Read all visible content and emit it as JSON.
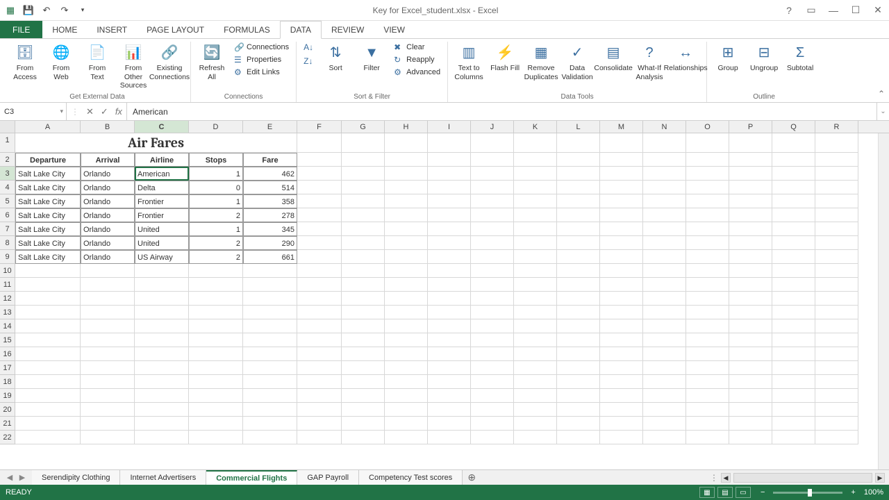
{
  "app": {
    "title": "Key for Excel_student.xlsx - Excel"
  },
  "qat": {
    "undo": "↶",
    "redo": "↷"
  },
  "ribbon_tabs": {
    "file": "FILE",
    "home": "HOME",
    "insert": "INSERT",
    "page_layout": "PAGE LAYOUT",
    "formulas": "FORMULAS",
    "data": "DATA",
    "review": "REVIEW",
    "view": "VIEW"
  },
  "ribbon": {
    "get_external": {
      "from_access": "From Access",
      "from_web": "From Web",
      "from_text": "From Text",
      "from_other": "From Other Sources",
      "existing": "Existing Connections",
      "label": "Get External Data"
    },
    "connections": {
      "refresh": "Refresh All",
      "connections": "Connections",
      "properties": "Properties",
      "edit_links": "Edit Links",
      "label": "Connections"
    },
    "sort_filter": {
      "sort": "Sort",
      "filter": "Filter",
      "clear": "Clear",
      "reapply": "Reapply",
      "advanced": "Advanced",
      "label": "Sort & Filter"
    },
    "data_tools": {
      "text_to_cols": "Text to Columns",
      "flash_fill": "Flash Fill",
      "remove_dups": "Remove Duplicates",
      "data_val": "Data Validation",
      "consolidate": "Consolidate",
      "what_if": "What-If Analysis",
      "relationships": "Relationships",
      "label": "Data Tools"
    },
    "outline": {
      "group": "Group",
      "ungroup": "Ungroup",
      "subtotal": "Subtotal",
      "label": "Outline"
    }
  },
  "formula_bar": {
    "cell_ref": "C3",
    "value": "American"
  },
  "columns": [
    "A",
    "B",
    "C",
    "D",
    "E",
    "F",
    "G",
    "H",
    "I",
    "J",
    "K",
    "L",
    "M",
    "N",
    "O",
    "P",
    "Q",
    "R"
  ],
  "title_text": "Air Fares",
  "headers": {
    "departure": "Departure",
    "arrival": "Arrival",
    "airline": "Airline",
    "stops": "Stops",
    "fare": "Fare"
  },
  "chart_data": {
    "type": "table",
    "columns": [
      "Departure",
      "Arrival",
      "Airline",
      "Stops",
      "Fare"
    ],
    "rows": [
      {
        "departure": "Salt Lake City",
        "arrival": "Orlando",
        "airline": "American",
        "stops": 1,
        "fare": 462
      },
      {
        "departure": "Salt Lake City",
        "arrival": "Orlando",
        "airline": "Delta",
        "stops": 0,
        "fare": 514
      },
      {
        "departure": "Salt Lake City",
        "arrival": "Orlando",
        "airline": "Frontier",
        "stops": 1,
        "fare": 358
      },
      {
        "departure": "Salt Lake City",
        "arrival": "Orlando",
        "airline": "Frontier",
        "stops": 2,
        "fare": 278
      },
      {
        "departure": "Salt Lake City",
        "arrival": "Orlando",
        "airline": "United",
        "stops": 1,
        "fare": 345
      },
      {
        "departure": "Salt Lake City",
        "arrival": "Orlando",
        "airline": "United",
        "stops": 2,
        "fare": 290
      },
      {
        "departure": "Salt Lake City",
        "arrival": "Orlando",
        "airline": "US Airway",
        "stops": 2,
        "fare": 661
      }
    ]
  },
  "sheet_tabs": {
    "t0": "Serendipity Clothing",
    "t1": "Internet Advertisers",
    "t2": "Commercial Flights",
    "t3": "GAP Payroll",
    "t4": "Competency Test scores"
  },
  "status": {
    "ready": "READY",
    "zoom": "100%"
  }
}
